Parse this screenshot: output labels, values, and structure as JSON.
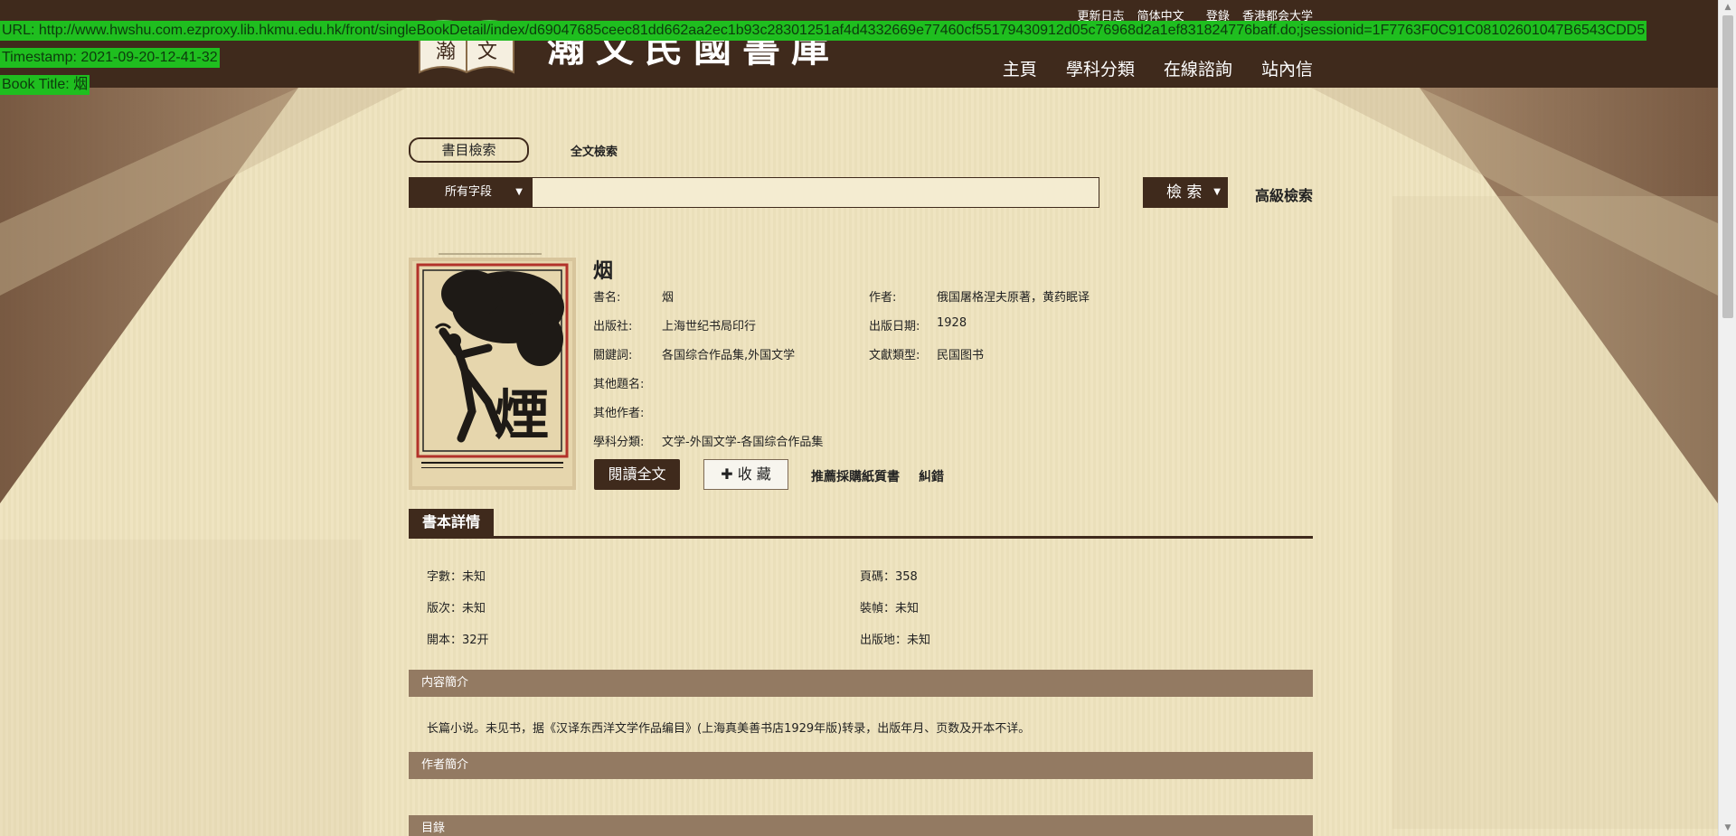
{
  "overlay": {
    "url": "URL: http://www.hwshu.com.ezproxy.lib.hkmu.edu.hk/front/singleBookDetail/index/d69047685ceec81dd662aa2ec1b93c28301251af4d4332669e77460cf55179430912d05c76968d2a1ef831824776baff.do;jsessionid=1F7763F0C91C08102601047B6543CDD5",
    "timestamp": "Timestamp: 2021-09-20-12-41-32",
    "book_title": "Book Title: 烟"
  },
  "header": {
    "site_name": "瀚文民國書庫",
    "top_links": [
      "更新日志",
      "简体中文",
      "登錄",
      "香港都会大学"
    ],
    "nav": [
      "主頁",
      "學科分類",
      "在線諮詢",
      "站內信"
    ]
  },
  "search": {
    "tab_catalog": "書目檢索",
    "tab_fulltext": "全文檢索",
    "field_select": "所有字段",
    "input_value": "",
    "search_button": "檢 索",
    "advanced": "高級檢索"
  },
  "book": {
    "title": "烟",
    "fields": {
      "name_label": "書名:",
      "name": "烟",
      "author_label": "作者:",
      "author": "俄国屠格涅夫原著，黄药眠译",
      "publisher_label": "出版社:",
      "publisher": "上海世纪书局印行",
      "date_label": "出版日期:",
      "date": "1928",
      "keywords_label": "關鍵詞:",
      "keywords": "各国综合作品集,外国文学",
      "doctype_label": "文獻類型:",
      "doctype": "民国图书",
      "other_title_label": "其他題名:",
      "other_title": "",
      "other_author_label": "其他作者:",
      "other_author": "",
      "subject_label": "學科分類:",
      "subject": "文学-外国文学-各国综合作品集"
    },
    "read_button": "閱讀全文",
    "fav_button": "收 藏",
    "recommend": "推薦採購紙質書",
    "error_report": "糾錯"
  },
  "details": {
    "heading": "書本詳情",
    "word_count": "字數：未知",
    "pages": "頁碼：358",
    "edition": "版次：未知",
    "binding": "裝幀：未知",
    "format": "開本：32开",
    "place": "出版地：未知"
  },
  "sections": {
    "summary_title": "内容簡介",
    "summary_text": "长篇小说。未见书，据《汉译东西洋文学作品编目》(上海真美善书店1929年版)转录，出版年月、页数及开本不详。",
    "author_title": "作者簡介",
    "toc_title": "目錄"
  },
  "colors": {
    "header_bg": "#3f2a1c",
    "section_bar": "#937a62",
    "overlay_green": "#1fbe1f"
  }
}
